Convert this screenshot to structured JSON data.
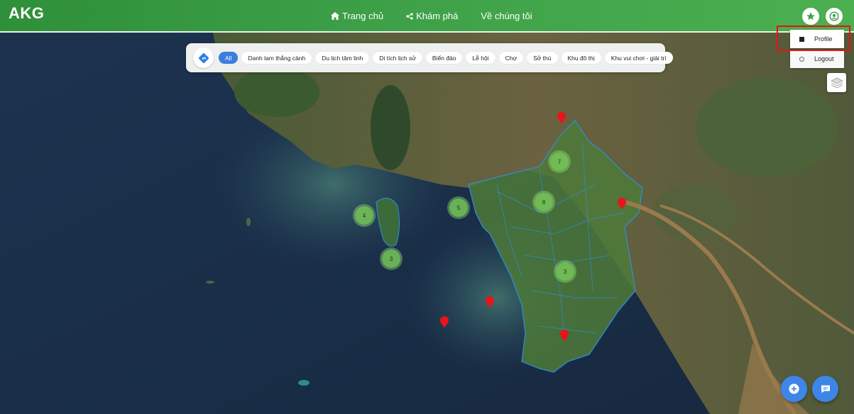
{
  "header": {
    "logo": "AKG",
    "nav": [
      {
        "label": "Trang chủ",
        "icon": "home-icon"
      },
      {
        "label": "Khám phá",
        "icon": "share-icon"
      },
      {
        "label": "Về chúng tôi",
        "icon": ""
      }
    ]
  },
  "user_menu": {
    "items": [
      {
        "label": "Profile",
        "icon": "profile-icon"
      },
      {
        "label": "Logout",
        "icon": "logout-icon"
      }
    ]
  },
  "filters": {
    "chips": [
      "All",
      "Danh lam thắng cảnh",
      "Du lịch tâm linh",
      "Di tích lịch sử",
      "Biển đảo",
      "Lễ hội",
      "Chợ",
      "Sở thú",
      "Khu đô thị",
      "Khu vui chơi - giải trí"
    ],
    "active": "All"
  },
  "map": {
    "clusters": [
      "7",
      "8",
      "5",
      "4",
      "3",
      "3"
    ],
    "pin_color": "#e8141b",
    "cluster_color": "#7cc85a"
  },
  "colors": {
    "header_green": "#3fa249",
    "accent_blue": "#3b7ee0",
    "highlight_red": "#e11111"
  }
}
